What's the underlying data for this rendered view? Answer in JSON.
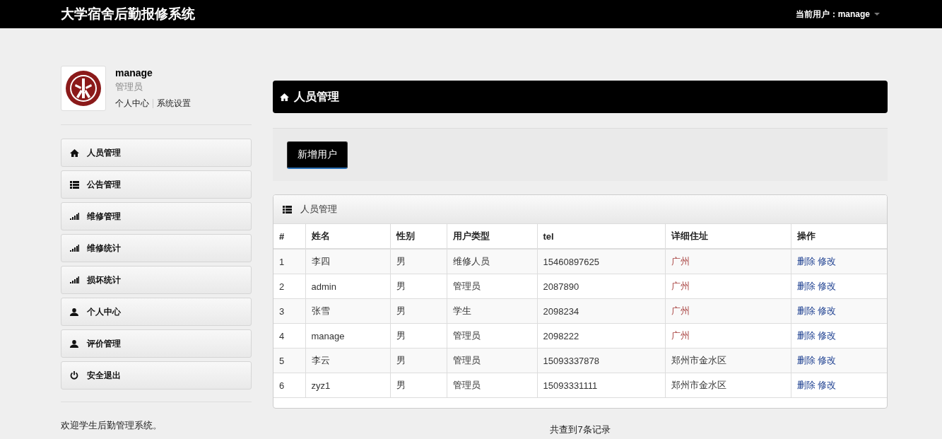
{
  "app_title": "大学宿舍后勤报修系统",
  "current_user": {
    "label": "当前用户：",
    "name": "manage"
  },
  "profile": {
    "name": "manage",
    "role": "管理员",
    "links": [
      "个人中心",
      "系统设置"
    ]
  },
  "sidebar": {
    "items": [
      {
        "label": "人员管理",
        "kind": "home"
      },
      {
        "label": "公告管理",
        "kind": "list"
      },
      {
        "label": "维修管理",
        "kind": "stats"
      },
      {
        "label": "维修统计",
        "kind": "stats"
      },
      {
        "label": "损坏统计",
        "kind": "stats"
      },
      {
        "label": "个人中心",
        "kind": "user"
      },
      {
        "label": "评价管理",
        "kind": "user"
      },
      {
        "label": "安全退出",
        "kind": "logout"
      }
    ],
    "footer": "欢迎学生后勤管理系统。"
  },
  "page_header": "人员管理",
  "add_button": "新增用户",
  "table": {
    "title": "人员管理",
    "columns": [
      "#",
      "姓名",
      "性别",
      "用户类型",
      "tel",
      "详细住址",
      "操作"
    ],
    "rows": [
      {
        "cells": [
          "1",
          "李四",
          "男",
          "维修人员",
          "15460897625"
        ],
        "address": {
          "text": "广州",
          "highlighted": true
        },
        "actions": [
          "删除",
          "修改"
        ]
      },
      {
        "cells": [
          "2",
          "admin",
          "男",
          "管理员",
          "2087890"
        ],
        "address": {
          "text": "广州",
          "highlighted": true
        },
        "actions": [
          "删除",
          "修改"
        ]
      },
      {
        "cells": [
          "3",
          "张雪",
          "男",
          "学生",
          "2098234"
        ],
        "address": {
          "text": "广州",
          "highlighted": true
        },
        "actions": [
          "删除",
          "修改"
        ]
      },
      {
        "cells": [
          "4",
          "manage",
          "男",
          "管理员",
          "2098222"
        ],
        "address": {
          "text": "广州",
          "highlighted": true
        },
        "actions": [
          "删除",
          "修改"
        ]
      },
      {
        "cells": [
          "5",
          "李云",
          "男",
          "管理员",
          "15093337878"
        ],
        "address": {
          "text": "郑州市金水区",
          "highlighted": false
        },
        "actions": [
          "删除",
          "修改"
        ]
      },
      {
        "cells": [
          "6",
          "zyz1",
          "男",
          "管理员",
          "15093331111"
        ],
        "address": {
          "text": "郑州市金水区",
          "highlighted": false
        },
        "actions": [
          "删除",
          "修改"
        ]
      }
    ]
  },
  "record_count": "共查到7条记录"
}
